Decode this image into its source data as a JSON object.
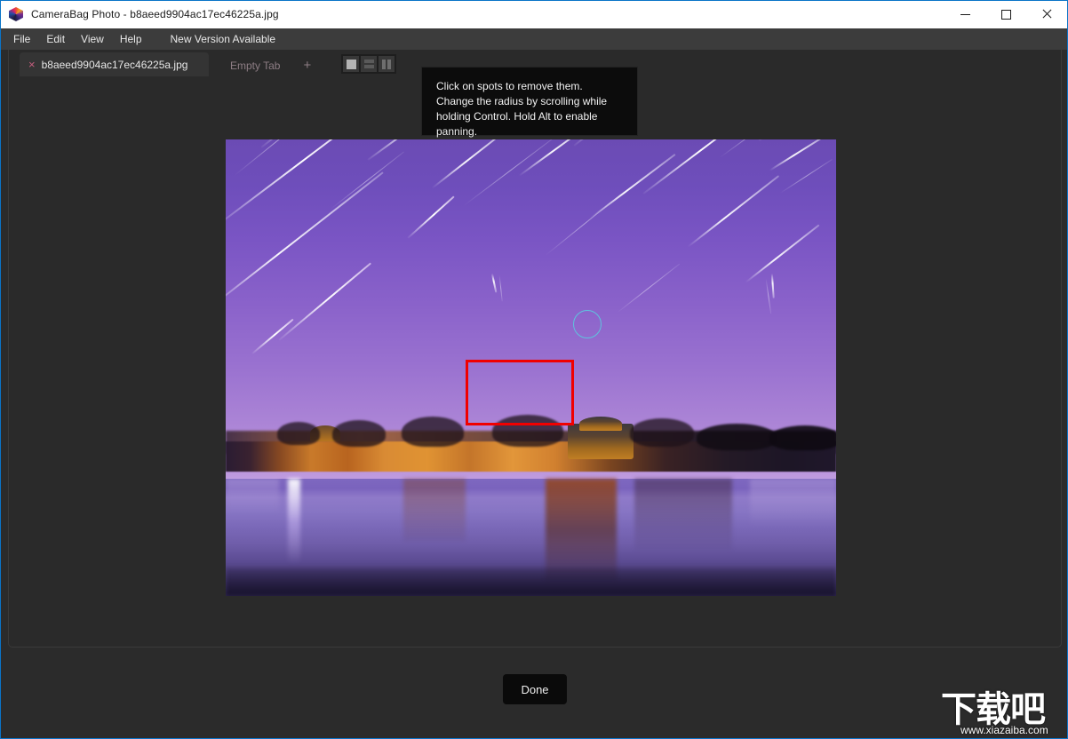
{
  "window": {
    "title": "CameraBag Photo - b8aeed9904ac17ec46225a.jpg",
    "app_icon": "camerabag-hex-icon",
    "controls": {
      "minimize": "minimize-icon",
      "maximize": "maximize-icon",
      "close": "close-icon"
    },
    "accent_border": "#0a74c8"
  },
  "menubar": {
    "items": [
      {
        "label": "File"
      },
      {
        "label": "Edit"
      },
      {
        "label": "View"
      },
      {
        "label": "Help"
      },
      {
        "label": "New Version Available"
      }
    ]
  },
  "tabs": {
    "active": {
      "label": "b8aeed9904ac17ec46225a.jpg",
      "close_glyph": "×"
    },
    "empty_tab_label": "Empty Tab",
    "new_tab_glyph": "+",
    "view_modes": [
      {
        "name": "single-pane",
        "selected": true
      },
      {
        "name": "horizontal-split",
        "selected": false
      },
      {
        "name": "vertical-split",
        "selected": false
      }
    ]
  },
  "tooltip": {
    "text": "Click on spots to remove them. Change the radius by scrolling while holding Control. Hold Alt to enable panning."
  },
  "canvas": {
    "image_description": "Night star-trail photograph of the Forbidden City corner tower reflected in water, purple sky",
    "spot_cursor": {
      "name": "spot-removal-brush",
      "color": "#5ec4de",
      "radius_px": 16
    },
    "selection_rect": {
      "name": "red-selection-rectangle",
      "color": "#f00000"
    }
  },
  "footer": {
    "done_label": "Done"
  },
  "watermark": {
    "chinese": "下载吧",
    "url": "www.xiazaiba.com"
  }
}
